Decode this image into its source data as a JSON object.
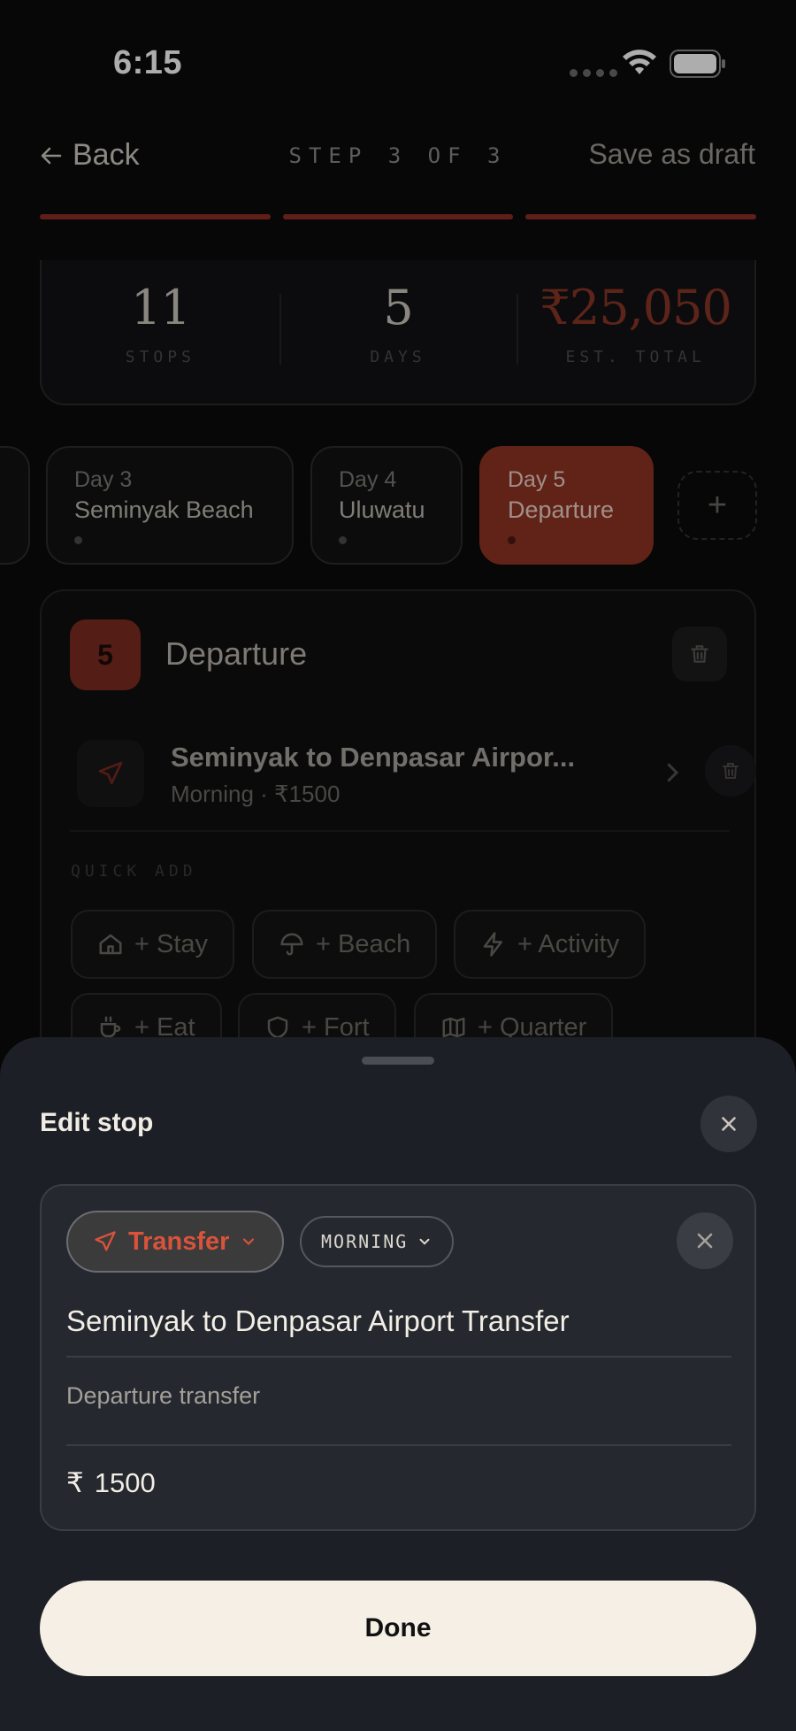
{
  "status": {
    "time": "6:15"
  },
  "header": {
    "back_label": "Back",
    "step": "STEP 3 OF 3",
    "draft_label": "Save as draft"
  },
  "summary": {
    "stops": {
      "value": "11",
      "label": "STOPS"
    },
    "days": {
      "value": "5",
      "label": "DAYS"
    },
    "total": {
      "value": "₹25,050",
      "label": "EST. TOTAL"
    }
  },
  "day_tabs": [
    {
      "day": "Day 3",
      "name": "Seminyak Beach"
    },
    {
      "day": "Day 4",
      "name": "Uluwatu"
    },
    {
      "day": "Day 5",
      "name": "Departure",
      "active": true
    }
  ],
  "add_day_label": "+",
  "day_card": {
    "number": "5",
    "title": "Departure",
    "stop": {
      "title": "Seminyak to Denpasar Airpor...",
      "subtitle": "Morning · ₹1500"
    },
    "quick_add_label": "QUICK ADD",
    "quick_add": [
      "+ Stay",
      "+ Beach",
      "+ Activity",
      "+ Eat",
      "+ Fort",
      "+ Quarter"
    ]
  },
  "sheet": {
    "title": "Edit stop",
    "type_label": "Transfer",
    "time_label": "MORNING",
    "name_value": "Seminyak to Denpasar Airport Transfer",
    "note_value": "Departure transfer",
    "currency": "₹",
    "price_value": "1500",
    "done_label": "Done"
  },
  "colors": {
    "accent": "#d9533b",
    "accent_dark": "#8f3424",
    "sheet_bg": "#1c1f25",
    "done_bg": "#f5efe6"
  }
}
